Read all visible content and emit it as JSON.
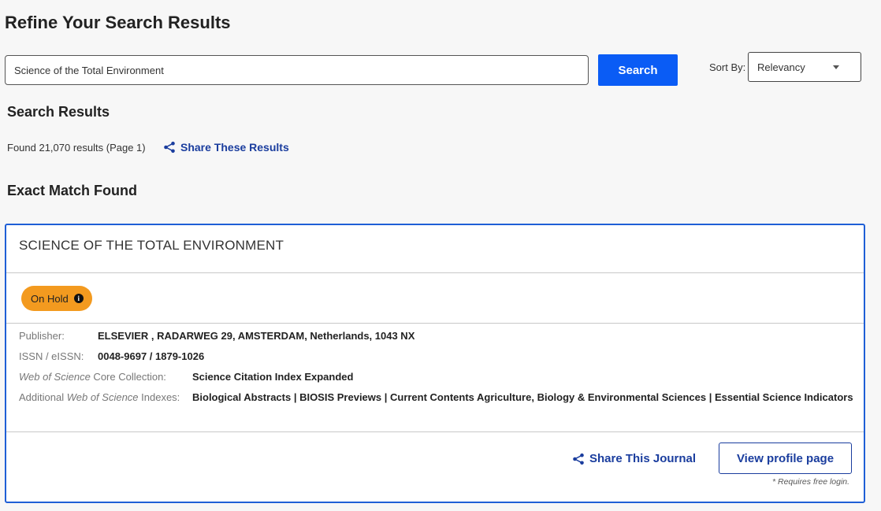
{
  "header": {
    "title": "Refine Your Search Results"
  },
  "search": {
    "value": "Science of the Total Environment",
    "button_label": "Search"
  },
  "sort": {
    "label": "Sort By:",
    "value": "Relevancy"
  },
  "results": {
    "heading": "Search Results",
    "count_text": "Found 21,070 results (Page 1)",
    "share_label": "Share These Results"
  },
  "exact_match": {
    "heading": "Exact Match Found"
  },
  "journal": {
    "title": "SCIENCE OF THE TOTAL ENVIRONMENT",
    "status_badge": "On Hold",
    "publisher_label": "Publisher:",
    "publisher_value": "ELSEVIER , RADARWEG 29, AMSTERDAM, Netherlands, 1043 NX",
    "issn_label": "ISSN / eISSN:",
    "issn_value": "0048-9697 / 1879-1026",
    "wos_label_italic": "Web of Science",
    "wos_label_rest": " Core Collection:",
    "wos_value": "Science Citation Index Expanded",
    "addl_label_prefix": "Additional ",
    "addl_label_italic": "Web of Science",
    "addl_label_rest": " Indexes:",
    "addl_value": "Biological Abstracts | BIOSIS Previews | Current Contents Agriculture, Biology & Environmental Sciences | Essential Science Indicators",
    "share_label": "Share This Journal",
    "profile_button": "View profile page",
    "login_note": "* Requires free login."
  },
  "colors": {
    "accent": "#0a5cf5",
    "link": "#1a3d9e",
    "badge": "#f39a1f",
    "card_border": "#1f5fd6"
  },
  "icons": [
    "share-icon",
    "info-icon",
    "chevron-down-icon"
  ]
}
